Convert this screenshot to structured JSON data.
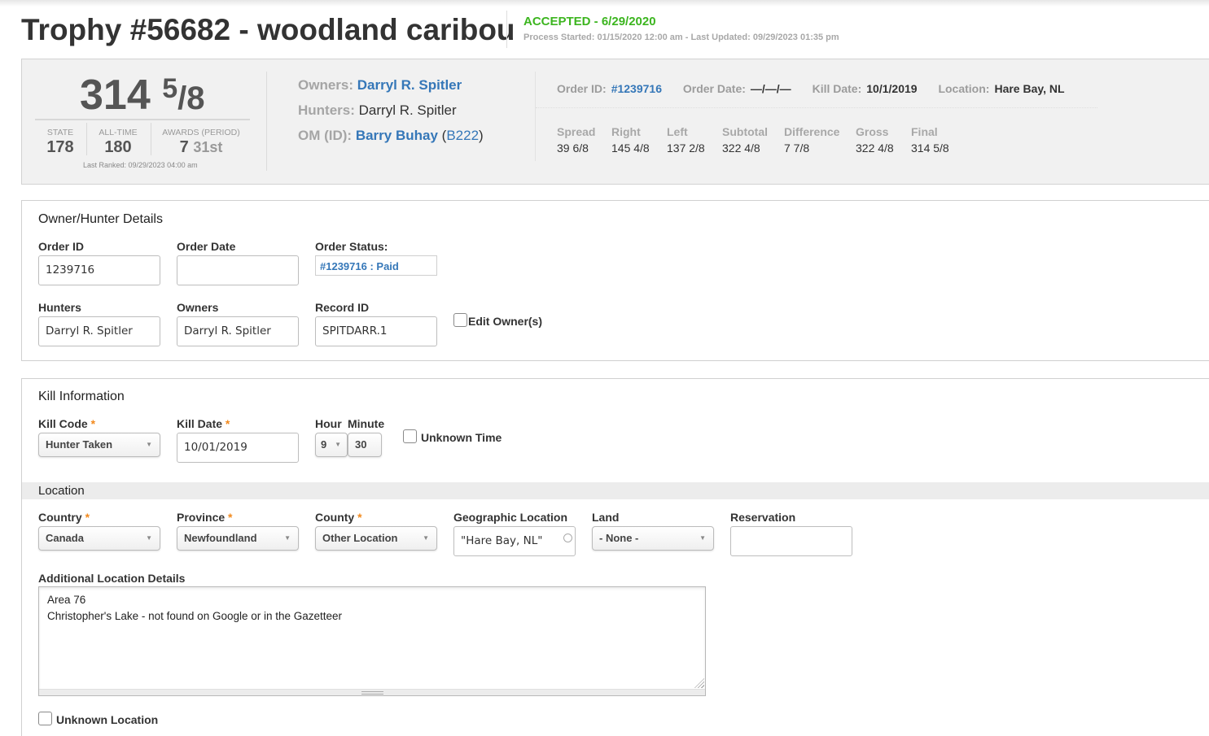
{
  "header": {
    "title": "Trophy #56682 - woodland caribou",
    "status": "ACCEPTED - 6/29/2020",
    "process_line": "Process Started: 01/15/2020 12:00 am - Last Updated: 09/29/2023 01:35 pm",
    "status_color": "#3cb51f"
  },
  "summary": {
    "score_whole": "314",
    "score_num": "5",
    "score_den": "8",
    "ranks": [
      {
        "label": "STATE",
        "value": "178"
      },
      {
        "label": "ALL-TIME",
        "value": "180"
      },
      {
        "label": "AWARDS (PERIOD)",
        "value": "7",
        "sub": "31st"
      }
    ],
    "last_ranked": "Last Ranked: 09/29/2023 04:00 am",
    "owners_label": "Owners:",
    "owners_value": "Darryl R. Spitler",
    "hunters_label": "Hunters:",
    "hunters_value": "Darryl R. Spitler",
    "om_label": "OM (ID):",
    "om_name": "Barry Buhay",
    "om_id": "B222",
    "info": {
      "order_id_label": "Order ID:",
      "order_id": "#1239716",
      "order_date_label": "Order Date:",
      "order_date": "—/—/—",
      "kill_date_label": "Kill Date:",
      "kill_date": "10/1/2019",
      "location_label": "Location:",
      "location": "Hare Bay, NL"
    },
    "measurements": [
      {
        "label": "Spread",
        "value": "39 6/8"
      },
      {
        "label": "Right",
        "value": "145 4/8"
      },
      {
        "label": "Left",
        "value": "137 2/8"
      },
      {
        "label": "Subtotal",
        "value": "322 4/8"
      },
      {
        "label": "Difference",
        "value": "7 7/8"
      },
      {
        "label": "Gross",
        "value": "322 4/8"
      },
      {
        "label": "Final",
        "value": "314 5/8"
      }
    ],
    "link_color": "#3577b8"
  },
  "owner_hunter": {
    "title": "Owner/Hunter Details",
    "order_id_label": "Order ID",
    "order_id_value": "1239716",
    "order_date_label": "Order Date",
    "order_date_value": "",
    "order_status_label": "Order Status:",
    "order_status_value": "#1239716 : Paid",
    "hunters_label": "Hunters",
    "hunters_value": "Darryl R. Spitler",
    "owners_label": "Owners",
    "owners_value": "Darryl R. Spitler",
    "record_id_label": "Record ID",
    "record_id_value": "SPITDARR.1",
    "edit_owners_label": "Edit Owner(s)",
    "edit_owners_checked": false
  },
  "kill_info": {
    "title": "Kill Information",
    "kill_code_label": "Kill Code",
    "kill_code_value": "Hunter Taken",
    "kill_date_label": "Kill Date",
    "kill_date_value": "10/01/2019",
    "hour_label": "Hour",
    "hour_value": "9",
    "minute_label": "Minute",
    "minute_value": "30",
    "unknown_time_label": "Unknown Time",
    "unknown_time_checked": false,
    "required_mark": "*"
  },
  "location": {
    "title": "Location",
    "country_label": "Country",
    "country_value": "Canada",
    "province_label": "Province",
    "province_value": "Newfoundland",
    "county_label": "County",
    "county_value": "Other Location",
    "geo_label": "Geographic Location",
    "geo_value": "\"Hare Bay, NL\"",
    "land_label": "Land",
    "land_value": "- None -",
    "reservation_label": "Reservation",
    "reservation_value": "",
    "details_label": "Additional Location Details",
    "details_value": "Area 76\nChristopher's Lake - not found on Google or in the Gazetteer",
    "unknown_location_label": "Unknown Location",
    "unknown_location_checked": false
  },
  "icons": {
    "dropdown_arrow": "▼"
  }
}
